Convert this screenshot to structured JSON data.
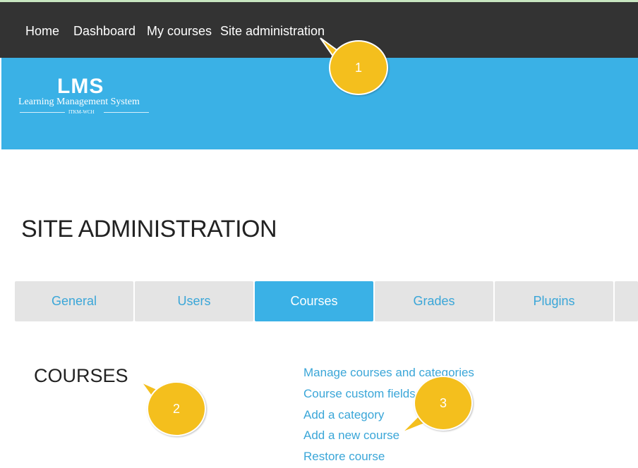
{
  "navbar": {
    "items": [
      {
        "label": "Home"
      },
      {
        "label": "Dashboard"
      },
      {
        "label": "My courses"
      },
      {
        "label": "Site administration"
      }
    ],
    "background": "#333333"
  },
  "logo": {
    "title": "LMS",
    "subtitle": "Learning Management System",
    "tagline": "ITKM-WCH"
  },
  "page": {
    "title": "SITE ADMINISTRATION"
  },
  "tabs": [
    {
      "label": "General",
      "active": false
    },
    {
      "label": "Users",
      "active": false
    },
    {
      "label": "Courses",
      "active": true
    },
    {
      "label": "Grades",
      "active": false
    },
    {
      "label": "Plugins",
      "active": false
    }
  ],
  "section": {
    "heading": "COURSES",
    "links": [
      {
        "label": "Manage courses and categories"
      },
      {
        "label": "Course custom fields"
      },
      {
        "label": "Add a category"
      },
      {
        "label": "Add a new course"
      },
      {
        "label": "Restore course"
      }
    ]
  },
  "callouts": [
    {
      "label": "1"
    },
    {
      "label": "2"
    },
    {
      "label": "3"
    }
  ],
  "colors": {
    "accent": "#3ab1e6",
    "link": "#3aa6d8",
    "tab_inactive": "#e4e4e4",
    "callout": "#f4bf1d"
  }
}
